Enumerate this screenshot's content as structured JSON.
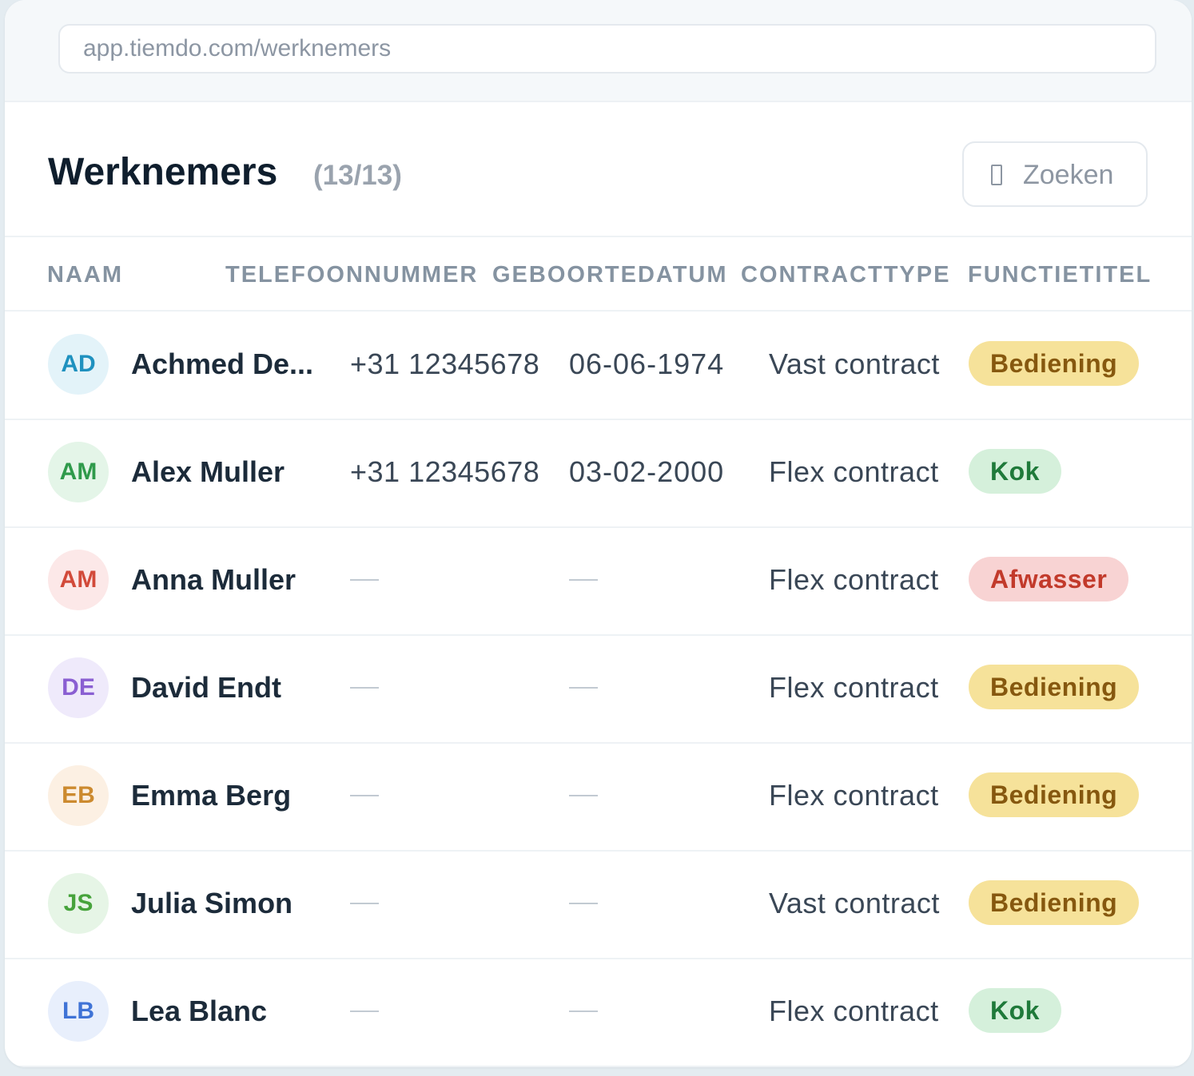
{
  "browser": {
    "url": "app.tiemdo.com/werknemers"
  },
  "header": {
    "title": "Werknemers",
    "count": "(13/13)",
    "search_label": "Zoeken"
  },
  "table": {
    "columns": [
      "NAAM",
      "TELEFOONNUMMER",
      "GEBOORTEDATUM",
      "CONTRACTTYPE",
      "FUNCTIETITEL"
    ],
    "empty_placeholder": "—",
    "rows": [
      {
        "initials": "AD",
        "name": "Achmed De...",
        "phone": "+31 12345678",
        "birthdate": "06-06-1974",
        "contract": "Vast contract",
        "role": "Bediening",
        "avatar_bg": "#e3f3f9",
        "avatar_fg": "#1f91bf",
        "badge_bg": "#f6e29a",
        "badge_fg": "#86580f"
      },
      {
        "initials": "AM",
        "name": "Alex Muller",
        "phone": "+31 12345678",
        "birthdate": "03-02-2000",
        "contract": "Flex contract",
        "role": "Kok",
        "avatar_bg": "#e4f5e8",
        "avatar_fg": "#2f9a4b",
        "badge_bg": "#d5f0db",
        "badge_fg": "#1f7a3a"
      },
      {
        "initials": "AM",
        "name": "Anna Muller",
        "phone": "",
        "birthdate": "",
        "contract": "Flex contract",
        "role": "Afwasser",
        "avatar_bg": "#fce8e8",
        "avatar_fg": "#d24a3a",
        "badge_bg": "#f8d3d3",
        "badge_fg": "#c23a2b"
      },
      {
        "initials": "DE",
        "name": "David Endt",
        "phone": "",
        "birthdate": "",
        "contract": "Flex contract",
        "role": "Bediening",
        "avatar_bg": "#efeafb",
        "avatar_fg": "#8a5fd2",
        "badge_bg": "#f6e29a",
        "badge_fg": "#86580f"
      },
      {
        "initials": "EB",
        "name": "Emma Berg",
        "phone": "",
        "birthdate": "",
        "contract": "Flex contract",
        "role": "Bediening",
        "avatar_bg": "#fcf0e3",
        "avatar_fg": "#cc8a2f",
        "badge_bg": "#f6e29a",
        "badge_fg": "#86580f"
      },
      {
        "initials": "JS",
        "name": "Julia Simon",
        "phone": "",
        "birthdate": "",
        "contract": "Vast contract",
        "role": "Bediening",
        "avatar_bg": "#e6f5e6",
        "avatar_fg": "#46a33b",
        "badge_bg": "#f6e29a",
        "badge_fg": "#86580f"
      },
      {
        "initials": "LB",
        "name": "Lea Blanc",
        "phone": "",
        "birthdate": "",
        "contract": "Flex contract",
        "role": "Kok",
        "avatar_bg": "#e8effc",
        "avatar_fg": "#3f73d6",
        "badge_bg": "#d5f0db",
        "badge_fg": "#1f7a3a"
      }
    ]
  }
}
